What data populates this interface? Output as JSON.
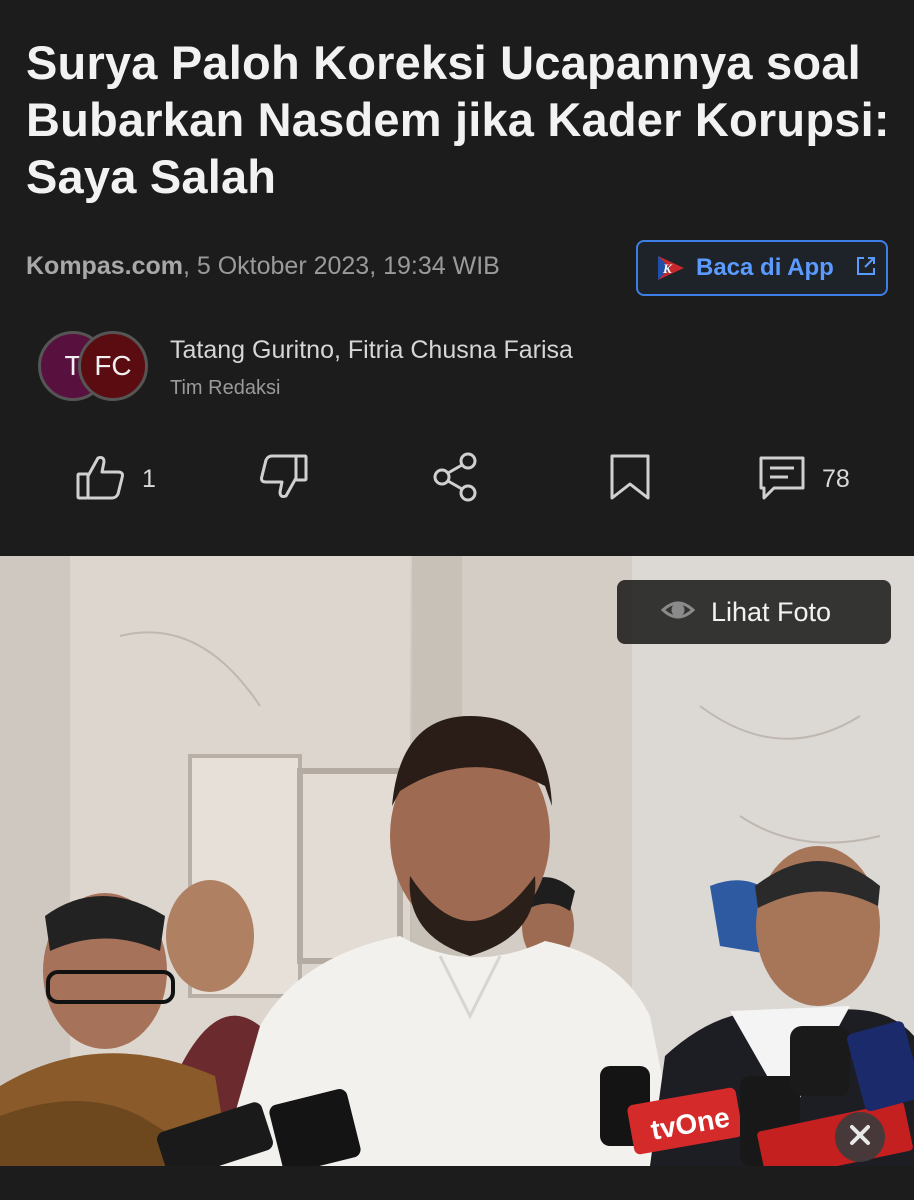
{
  "article": {
    "headline": "Surya Paloh Koreksi Ucapannya soal Bubarkan Nasdem jika Kader Korupsi: Saya Salah",
    "source": "Kompas.com",
    "datetime": ", 5 Oktober 2023, 19:34 WIB"
  },
  "app_button": {
    "label": "Baca di App",
    "logo_letter": "K"
  },
  "authors": {
    "avatars": [
      "T",
      "FC"
    ],
    "names": "Tatang Guritno, Fitria Chusna Farisa",
    "role": "Tim Redaksi"
  },
  "actions": {
    "like_count": "1",
    "comment_count": "78",
    "icons": [
      "thumbs-up-icon",
      "thumbs-down-icon",
      "share-icon",
      "bookmark-icon",
      "comment-icon"
    ]
  },
  "photo": {
    "view_label": "Lihat Foto"
  },
  "colors": {
    "background": "#1c1c1c",
    "accent": "#3d7fe6",
    "accent_text": "#5b9bff"
  }
}
